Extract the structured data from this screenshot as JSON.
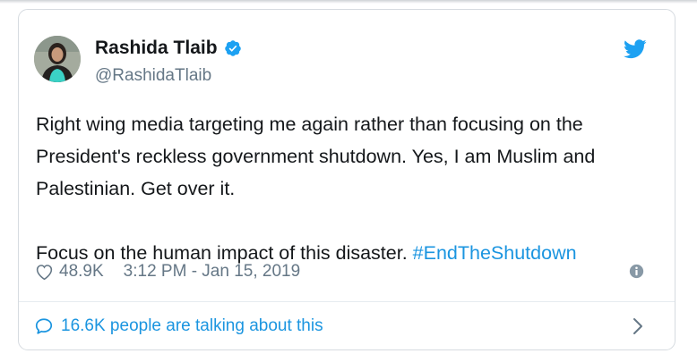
{
  "tweet": {
    "author_name": "Rashida Tlaib",
    "author_handle": "@RashidaTlaib",
    "text_paragraph_1": "Right wing media targeting me again rather than focusing on the President's reckless government shutdown. Yes, I am Muslim and Palestinian. Get over it.",
    "text_paragraph_2_prefix": "Focus on the human impact of this disaster. ",
    "hashtag": "#EndTheShutdown",
    "likes": "48.9K",
    "timestamp": "3:12 PM - Jan 15, 2019",
    "talking_about": "16.6K people are talking about this"
  },
  "icons": {
    "verified": "verified-badge-icon",
    "brand": "twitter-bird-icon",
    "like": "heart-icon",
    "info": "info-icon",
    "reply": "speech-bubble-icon",
    "chevron": "chevron-right-icon"
  },
  "colors": {
    "accent": "#1b95e0",
    "text": "#14171a",
    "muted": "#657786",
    "border": "#d6dbe0"
  }
}
